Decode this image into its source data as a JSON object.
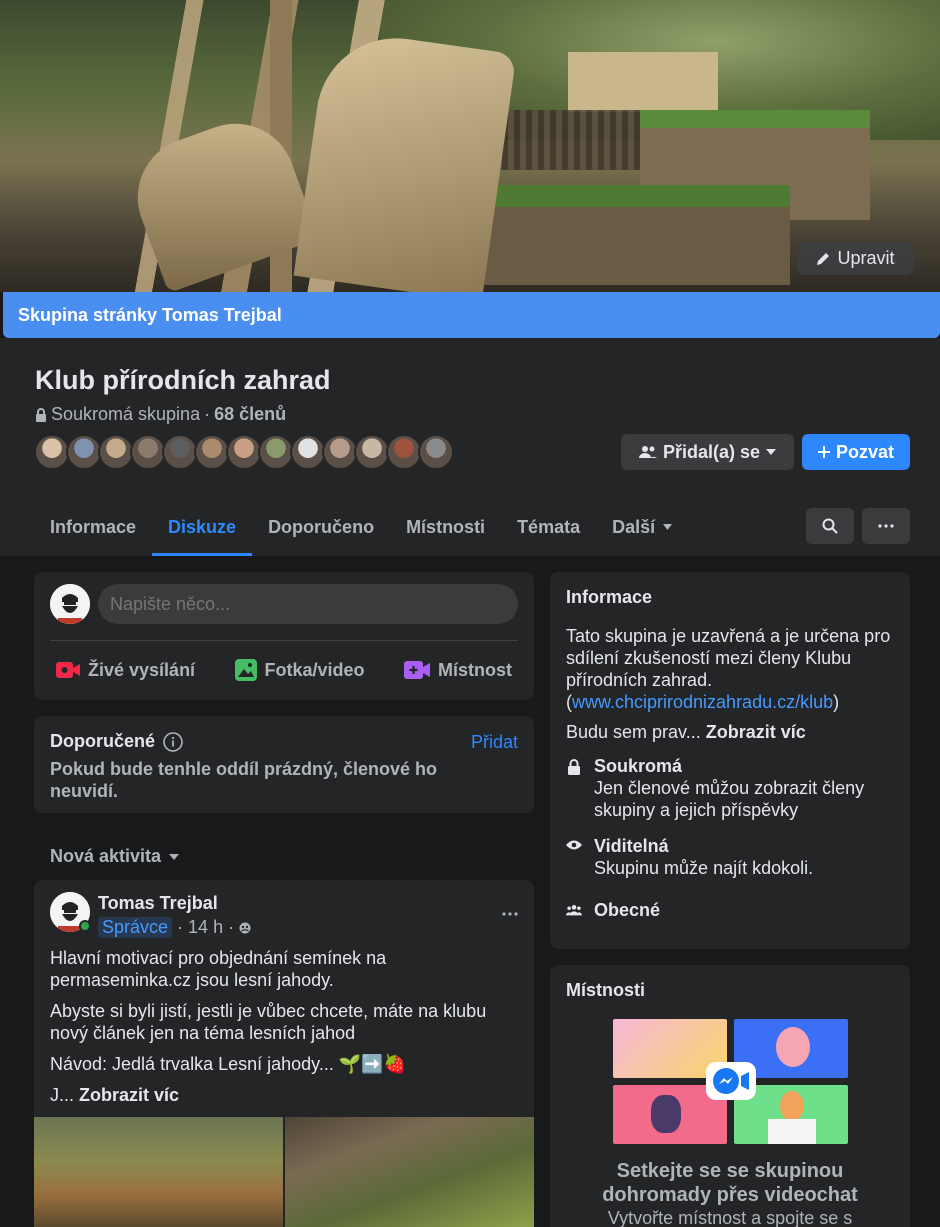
{
  "cover": {
    "edit_label": "Upravit"
  },
  "banner": {
    "text": "Skupina stránky Tomas Trejbal"
  },
  "group": {
    "name": "Klub přírodních zahrad",
    "privacy": "Soukromá skupina",
    "separator": "·",
    "members": "68 členů",
    "avatar_colors": [
      "#d9c2a8",
      "#7f93b0",
      "#c4a98a",
      "#8c7b6a",
      "#5d5d5d",
      "#a88c6c",
      "#c9a086",
      "#8a9a6a",
      "#e1e1e1",
      "#b59b8a",
      "#c7b7a3",
      "#a0523d",
      "#8a8a8a"
    ]
  },
  "buttons": {
    "joined": "Přidal(a) se",
    "invite": "Pozvat"
  },
  "tabs": [
    {
      "label": "Informace"
    },
    {
      "label": "Diskuze"
    },
    {
      "label": "Doporučeno"
    },
    {
      "label": "Místnosti"
    },
    {
      "label": "Témata"
    },
    {
      "label": "Další"
    }
  ],
  "composer": {
    "placeholder": "Napište něco...",
    "live": "Živé vysílání",
    "photo": "Fotka/video",
    "room": "Místnost"
  },
  "recommended": {
    "title": "Doporučené",
    "add": "Přidat",
    "desc": "Pokud bude tenhle oddíl prázdný, členové ho neuvidí."
  },
  "activity": {
    "label": "Nová aktivita"
  },
  "post": {
    "author": "Tomas Trejbal",
    "role": "Správce",
    "time": "14 h",
    "p1": "Hlavní motivací pro objednání semínek na permaseminka.cz jsou lesní jahody.",
    "p2": "Abyste si byli jistí, jestli je vůbec chcete, máte na klubu nový článek jen na téma lesních jahod",
    "p3": "Návod: Jedlá trvalka Lesní jahody... 🌱➡️🍓",
    "p4_prefix": "J...",
    "show_more": "Zobrazit víc"
  },
  "info": {
    "title": "Informace",
    "desc_text": "Tato skupina je uzavřená a je určena pro sdílení zkušeností mezi členy Klubu přírodních zahrad. (",
    "link": "www.chciprirodnizahradu.cz/klub",
    "desc_end": ")",
    "more_prefix": "Budu sem prav...",
    "more": "Zobrazit víc",
    "private_title": "Soukromá",
    "private_desc": "Jen členové můžou zobrazit členy skupiny a jejich příspěvky",
    "visible_title": "Viditelná",
    "visible_desc": "Skupinu může najít kdokoli.",
    "general_title": "Obecné"
  },
  "rooms": {
    "title": "Místnosti",
    "cta": "Setkejte se se skupinou dohromady přes videochat",
    "sub": "Vytvořte místnost a spojte se s"
  },
  "colors": {
    "accent": "#2d88ff",
    "banner": "#4b8ef1",
    "bg": "#18191a",
    "card": "#242526"
  }
}
